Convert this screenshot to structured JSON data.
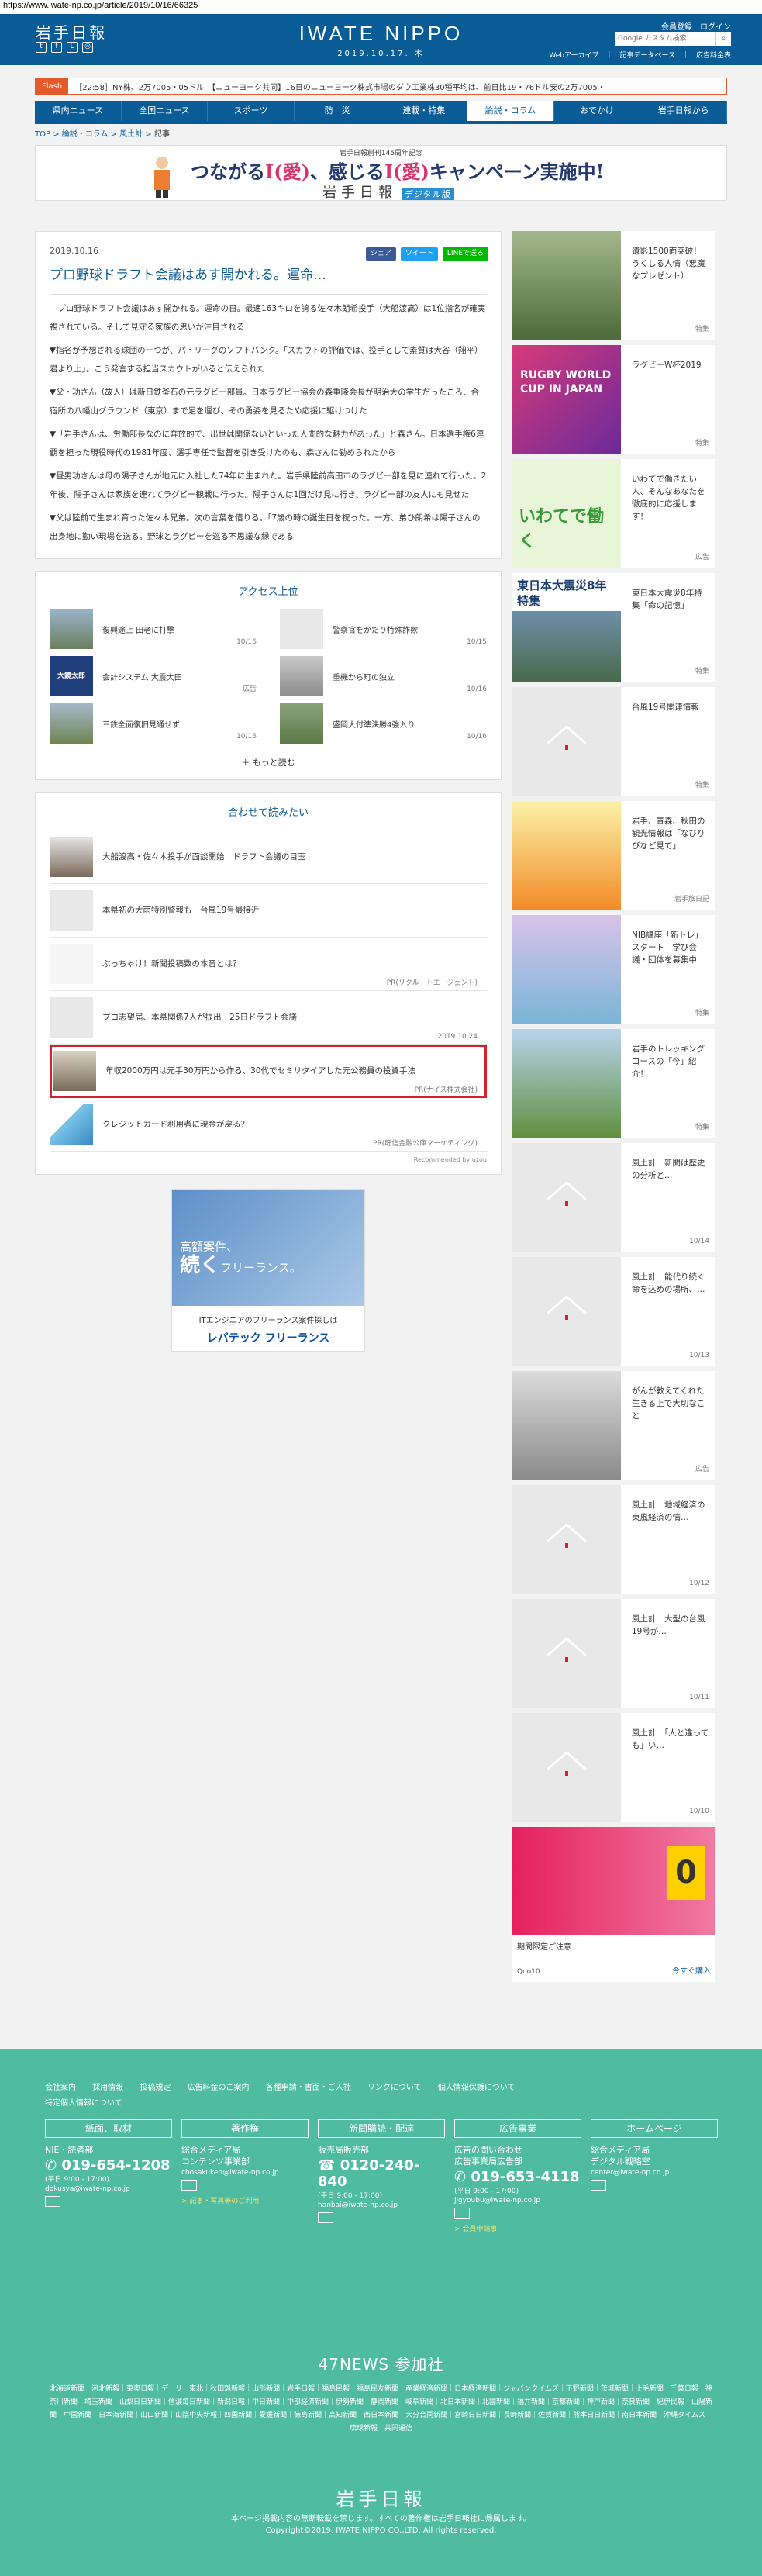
{
  "url": "https://www.iwate-np.co.jp/article/2019/10/16/66325",
  "header": {
    "logo": "岩手日報",
    "brand": "IWATE NIPPO",
    "date": "2019.10.17. 木",
    "links": "会員登録　ログイン",
    "search_placeholder": "Google カスタム検索",
    "sub": "Webアーカイブ　｜　記事データベース　｜　広告料金表",
    "colors": {
      "brand": "#0a5c97",
      "flash": "#e45a2a",
      "footer": "#4fbba1"
    }
  },
  "flash": {
    "tag": "Flash",
    "text": "［22:58］NY株、2万7005・05ドル　【ニューヨーク共同】16日のニューヨーク株式市場のダウ工業株30種平均は、前日比19・76ドル安の2万7005・"
  },
  "nav": [
    "県内ニュース",
    "全国ニュース",
    "スポーツ",
    "防　災",
    "連載・特集",
    "論説・コラム",
    "おでかけ",
    "岩手日報から"
  ],
  "breadcrumb": [
    "TOP",
    "論説・コラム",
    "風土計",
    "記事"
  ],
  "banner": {
    "small": "岩手日報創刊145周年記念",
    "main1": "つながる",
    "main2": "I(愛)",
    "main3": "、感じる",
    "main4": "I(愛)",
    "main5": "キャンペーン実施中!",
    "sub": "岩手日報",
    "sub_tag": "デジタル版"
  },
  "article": {
    "date": "2019.10.16",
    "share": [
      "シェア",
      "ツイート",
      "LINEで送る"
    ],
    "title": "プロ野球ドラフト会議はあす開かれる。運命…",
    "paras": [
      "　プロ野球ドラフト会議はあす開かれる。運命の日。最速163キロを誇る佐々木朗希投手（大船渡高）は1位指名が確実視されている。そして見守る家族の思いが注目される",
      "▼指名が予想される球団の一つが、パ・リーグのソフトバンク。「スカウトの評価では、投手として素質は大谷（翔平）君より上」。こう発言する担当スカウトがいると伝えられた",
      "▼父・功さん（故人）は新日鉄釜石の元ラグビー部員。日本ラグビー協会の森重隆会長が明治大の学生だったころ、合宿所の八幡山グラウンド（東京）まで足を運び、その勇姿を見るため応援に駆けつけた",
      "▼「岩手さんは、労働部長なのに奔放的で、出世は関係ないといった人間的な魅力があった」と森さん。日本選手権6連覇を担った現役時代の1981年度、選手専任で監督を引き受けたのも、森さんに勧められたから",
      "▼昼男功さんは母の陽子さんが地元に入社した74年に生まれた。岩手県陸前高田市のラグビー部を見に連れて行った。2年後、陽子さんは家族を連れてラグビー観戦に行った。陽子さんは1回だけ見に行き、ラグビー部の友人にも見せた",
      "▼父は陸前で生まれ育った佐々木兄弟。次の言葉を借りる。「7歳の時の誕生日を祝った。一方、弟ひ朗希は陽子さんの出身地に勤い現場を送る。野球とラグビーを巡る不思議な縁である"
    ]
  },
  "access": {
    "title": "アクセス上位",
    "items": [
      {
        "text": "復興途上 田老に打撃",
        "date": "10/16"
      },
      {
        "text": "警察官をかたり特殊詐欺",
        "date": "10/15"
      },
      {
        "text": "会計システム 大震大田",
        "date": "広告"
      },
      {
        "text": "重機から町の独立",
        "date": "10/16"
      },
      {
        "text": "三鉄全面復旧見通せず",
        "date": "10/16"
      },
      {
        "text": "盛岡大付準決勝4強入り",
        "date": "10/16"
      }
    ],
    "more": "もっと読む"
  },
  "related": {
    "title": "合わせて読みたい",
    "items": [
      {
        "text": "大船渡高・佐々木投手が面談開始　ドラフト会議の目玉",
        "pr": ""
      },
      {
        "text": "本県初の大雨特別警報も　台風19号最接近",
        "pr": ""
      },
      {
        "text": "ぶっちゃけ！新聞投稿数の本音とは？",
        "pr": "PR(リクルートエージェント)"
      },
      {
        "text": "プロ志望届、本県関係7人が提出　25日ドラフト会議",
        "pr": "2019.10.24"
      },
      {
        "text": "年収2000万円は元手30万円から作る、30代でセミリタイアした元公務員の投資手法",
        "pr": "PR(ナイス株式会社)"
      },
      {
        "text": "クレジットカード利用者に現金が戻る？",
        "pr": "PR(旺信金融公庫マーケティング)"
      }
    ],
    "recommended": "Recommended by uzou"
  },
  "ad2": {
    "line1": "高額案件、",
    "line2": "続く",
    "line3": "フリーランス。",
    "text": "ITエンジニアのフリーランス案件探しは",
    "logo": "レバテック フリーランス"
  },
  "sidebar": [
    {
      "text": "遺影1500面突破！うくしる人情（悪魔なプレゼント）",
      "tag": "特集"
    },
    {
      "text": "ラグビーW杯2019",
      "tag": "特集",
      "img_text": "RUGBY WORLD CUP IN JAPAN"
    },
    {
      "text": "いわてで働きたい人、そんなあなたを徹底的に応援します！",
      "tag": "広告",
      "img_text": "いわてで働く"
    },
    {
      "text": "東日本大震災8年特集「命の記憶」",
      "tag": "特集",
      "img_text": "東日本大震災8年特集"
    },
    {
      "text": "台風19号関連情報",
      "tag": "特集"
    },
    {
      "text": "岩手、青森、秋田の観光情報は「なびりびなど見て」",
      "tag": "岩手旅日記"
    },
    {
      "text": "NIB講座「新トレ」スタート　学び会議・団体を募集中",
      "tag": "特集"
    },
    {
      "text": "岩手のトレッキングコースの「今」紹介！",
      "tag": "特集"
    },
    {
      "text": "風土計　新聞は歴史の分析と…",
      "tag": "10/14"
    },
    {
      "text": "風土計　能代り続く命を込めの場所、…",
      "tag": "10/13"
    },
    {
      "text": "がんが教えてくれた生きる上で大切なこと",
      "tag": "広告"
    },
    {
      "text": "風土計　地域経済の東風経済の情…",
      "tag": "10/12"
    },
    {
      "text": "風土計　大型の台風19号が…",
      "tag": "10/11"
    },
    {
      "text": "風土計　「人と違っても」い…",
      "tag": "10/10"
    }
  ],
  "sidead": {
    "title": "期間限定ご注意",
    "shop": "Qoo10",
    "link": "今すぐ購入"
  },
  "footer": {
    "links": [
      "会社案内",
      "採用情報",
      "投稿規定",
      "広告料金のご案内",
      "各種申請・書面・ご入社",
      "リンクについて",
      "個人情報保護について",
      "特定個人情報について"
    ],
    "blocks": [
      {
        "head": "紙面、取材",
        "name": "NIE・読者部",
        "phone": "019-654-1208",
        "hours": "(平日 9:00 - 17:00)",
        "mail": "dokusya@iwate-np.co.jp",
        "note": ""
      },
      {
        "head": "著作権",
        "name": "総合メディア局\nコンテンツ事業部",
        "phone": "",
        "hours": "",
        "mail": "chosakuken@iwate-np.co.jp",
        "note": "> 記事・写真等のご利用"
      },
      {
        "head": "新聞購読・配達",
        "name": "販売局販売部",
        "phone": "0120-240-840",
        "hours": "(平日 9:00 - 17:00)",
        "mail": "hanbai@iwate-np.co.jp",
        "note": ""
      },
      {
        "head": "広告事業",
        "name": "広告の問い合わせ\n広告事業局広告部",
        "phone": "019-653-4118",
        "hours": "(平日 9:00 - 17:00)",
        "mail": "jigyoubu@iwate-np.co.jp",
        "note": "> 会員申請事"
      },
      {
        "head": "ホームページ",
        "name": "総合メディア局\nデジタル戦略室",
        "phone": "",
        "hours": "",
        "mail": "center@iwate-np.co.jp",
        "note": ""
      }
    ],
    "news47": "47NEWS 参加社",
    "papers": "北海道新聞｜河北新報｜東奥日報｜デーリー東北｜秋田魁新報｜山形新聞｜岩手日報｜福島民報｜福島民友新聞｜産業経済新聞｜日本経済新聞｜ジャパンタイムズ｜下野新聞｜茨城新聞｜上毛新聞｜千葉日報｜神奈川新聞｜埼玉新聞｜山梨日日新聞｜信濃毎日新聞｜新潟日報｜中日新聞｜中部経済新聞｜伊勢新聞｜静岡新聞｜岐阜新聞｜北日本新聞｜北國新聞｜福井新聞｜京都新聞｜神戸新聞｜奈良新聞｜紀伊民報｜山陽新聞｜中国新聞｜日本海新聞｜山口新聞｜山陰中央新報｜四国新聞｜愛媛新聞｜徳島新聞｜高知新聞｜西日本新聞｜大分合同新聞｜宮崎日日新聞｜長崎新聞｜佐賀新聞｜熊本日日新聞｜南日本新聞｜沖縄タイムス｜琉球新報｜共同通信",
    "logo": "岩手日報",
    "copy1": "本ページ掲載内容の無断転載を禁じます。すべての著作権は岩手日報社に帰属します。",
    "copy2": "Copyright©2019, IWATE NIPPO CO.,LTD. All rights reserved."
  }
}
